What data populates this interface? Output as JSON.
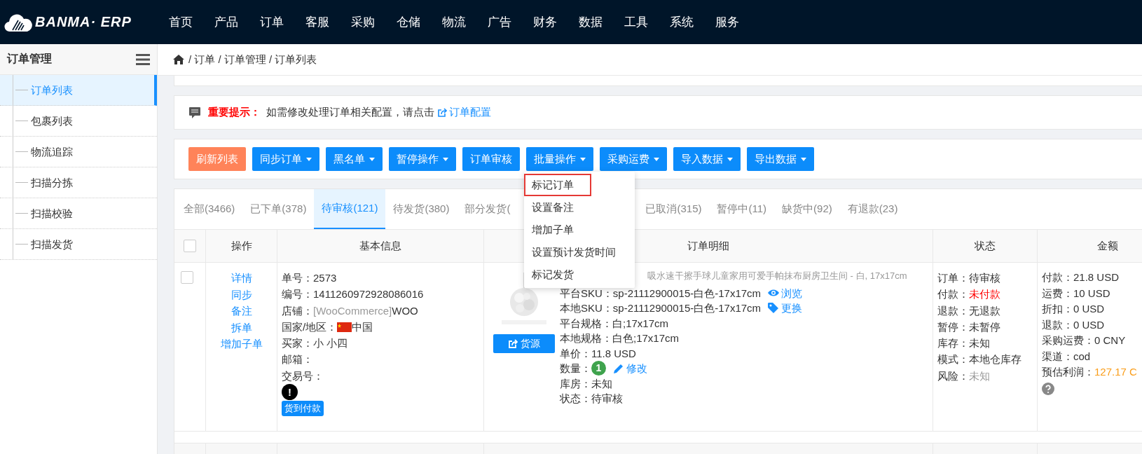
{
  "brand": {
    "name": "BANMA· ERP"
  },
  "nav": [
    {
      "label": "首页"
    },
    {
      "label": "产品"
    },
    {
      "label": "订单"
    },
    {
      "label": "客服"
    },
    {
      "label": "采购"
    },
    {
      "label": "仓储"
    },
    {
      "label": "物流"
    },
    {
      "label": "广告"
    },
    {
      "label": "财务"
    },
    {
      "label": "数据"
    },
    {
      "label": "工具"
    },
    {
      "label": "系统"
    },
    {
      "label": "服务"
    }
  ],
  "sidebar": {
    "title": "订单管理",
    "items": [
      {
        "label": "订单列表",
        "selected": true
      },
      {
        "label": "包裹列表",
        "selected": false
      },
      {
        "label": "物流追踪",
        "selected": false
      },
      {
        "label": "扫描分拣",
        "selected": false
      },
      {
        "label": "扫描校验",
        "selected": false
      },
      {
        "label": "扫描发货",
        "selected": false
      }
    ]
  },
  "breadcrumb": "/ 订单 / 订单管理 / 订单列表",
  "notice": {
    "title": "重要提示：",
    "text": "如需修改处理订单相关配置，请点击",
    "link": "订单配置"
  },
  "toolbar": [
    {
      "label": "刷新列表",
      "kind": "warning",
      "caret": false
    },
    {
      "label": "同步订单",
      "kind": "primary",
      "caret": true
    },
    {
      "label": "黑名单",
      "kind": "primary",
      "caret": true
    },
    {
      "label": "暂停操作",
      "kind": "primary",
      "caret": true
    },
    {
      "label": "订单审核",
      "kind": "primary",
      "caret": false
    },
    {
      "label": "批量操作",
      "kind": "primary",
      "caret": true
    },
    {
      "label": "采购运费",
      "kind": "primary",
      "caret": true
    },
    {
      "label": "导入数据",
      "kind": "primary",
      "caret": true
    },
    {
      "label": "导出数据",
      "kind": "primary",
      "caret": true
    }
  ],
  "dropdown": [
    {
      "label": "标记订单",
      "selected": true
    },
    {
      "label": "设置备注",
      "selected": false
    },
    {
      "label": "增加子单",
      "selected": false
    },
    {
      "label": "设置预计发货时间",
      "selected": false
    },
    {
      "label": "标记发货",
      "selected": false
    }
  ],
  "tabs": [
    {
      "label": "全部(3466)",
      "selected": false
    },
    {
      "label": "已下单(378)",
      "selected": false
    },
    {
      "label": "待审核(121)",
      "selected": true
    },
    {
      "label": "待发货(380)",
      "selected": false
    },
    {
      "label": "部分发货(",
      "selected": false
    },
    {
      "label": "已取消(315)",
      "selected": false
    },
    {
      "label": "暂停中(11)",
      "selected": false
    },
    {
      "label": "缺货中(92)",
      "selected": false
    },
    {
      "label": "有退款(23)",
      "selected": false
    }
  ],
  "table": {
    "select_all_checked": false,
    "columns": [
      "操作",
      "基本信息",
      "订单明细",
      "状态",
      "金额"
    ],
    "rows": [
      {
        "checked": false,
        "actions": [
          "详情",
          "同步",
          "备注",
          "拆单",
          "增加子单"
        ],
        "basic": [
          {
            "label": "单号：",
            "value": "2573"
          },
          {
            "label": "编号：",
            "value": "1411260972928086016"
          },
          {
            "label": "店铺：",
            "prefix": "[WooCommerce]",
            "value": "WOO"
          },
          {
            "label": "国家/地区：",
            "flag": true,
            "value": "中国"
          },
          {
            "label": "买家：",
            "value": "小 小四"
          },
          {
            "label": "邮箱："
          },
          {
            "label": "交易号："
          }
        ],
        "alert": "!",
        "payment_badge": "货到付款",
        "source_button": "货源",
        "product_title": "吸水速干擦手球儿童家用可爱手帕抹布厨房卫生间 - 白, 17x17cm",
        "details": [
          {
            "label": "平台SKU：",
            "value": "sp-21112900015-白色-17x17cm",
            "link": "浏览",
            "kind": "view"
          },
          {
            "label": "本地SKU：",
            "value": "sp-21112900015-白色-17x17cm",
            "link": "更换",
            "kind": "swap"
          },
          {
            "label": "平台规格：",
            "value": "白;17x17cm"
          },
          {
            "label": "本地规格：",
            "value": "白色;17x17cm"
          },
          {
            "label": "单价：",
            "value": "11.8 USD"
          },
          {
            "label": "数量：",
            "count": "1",
            "link": "修改",
            "kind": "edit"
          },
          {
            "label": "库房：",
            "value": "未知"
          },
          {
            "label": "状态：",
            "value": "待审核"
          }
        ],
        "status": [
          {
            "label": "订单：",
            "value": "待审核",
            "kind": "normal"
          },
          {
            "label": "付款：",
            "value": "未付款",
            "kind": "danger"
          },
          {
            "label": "退款：",
            "value": "无退款",
            "kind": "normal"
          },
          {
            "label": "暂停：",
            "value": "未暂停",
            "kind": "normal"
          },
          {
            "label": "库存：",
            "value": "未知",
            "kind": "normal"
          },
          {
            "label": "模式：",
            "value": "本地仓库存",
            "kind": "normal"
          },
          {
            "label": "风险：",
            "value": "未知",
            "kind": "muted"
          }
        ],
        "amounts": [
          {
            "label": "付款：",
            "value": "21.8 USD",
            "kind": "normal"
          },
          {
            "label": "运费：",
            "value": "10 USD",
            "kind": "normal"
          },
          {
            "label": "折扣：",
            "value": "0 USD",
            "kind": "normal"
          },
          {
            "label": "退款：",
            "value": "0 USD",
            "kind": "normal"
          },
          {
            "label": "采购运费：",
            "value": "0 CNY",
            "kind": "normal"
          },
          {
            "label": "渠道：",
            "value": "cod",
            "kind": "normal"
          },
          {
            "label": "预估利润：",
            "value": "127.17 C",
            "kind": "warning"
          }
        ]
      }
    ]
  }
}
